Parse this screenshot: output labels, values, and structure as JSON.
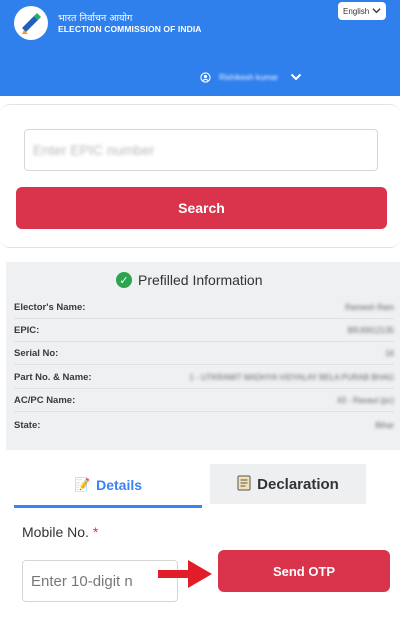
{
  "header": {
    "title_hindi": "भारत निर्वाचन आयोग",
    "title_english": "ELECTION COMMISSION OF INDIA",
    "language": "English",
    "user_name": "Rishikesh kumar"
  },
  "search": {
    "placeholder": "Enter EPIC number",
    "button_label": "Search"
  },
  "prefilled": {
    "title": "Prefilled Information",
    "rows": [
      {
        "label": "Elector's Name:",
        "value": "Ramesh Ram"
      },
      {
        "label": "EPIC:",
        "value": "BRJ0912135"
      },
      {
        "label": "Serial No:",
        "value": "16"
      },
      {
        "label": "Part No. & Name:",
        "value": "1 - UTKRAMIT MADHYA VIDYALAY BELA PURAB BHAG"
      },
      {
        "label": "AC/PC Name:",
        "value": "43 - Raxaul (pc)"
      },
      {
        "label": "State:",
        "value": "Bihar"
      }
    ]
  },
  "tabs": {
    "details_label": "Details",
    "declaration_label": "Declaration"
  },
  "mobile": {
    "label": "Mobile No.",
    "required_mark": "*",
    "placeholder": "Enter 10-digit n",
    "send_otp_label": "Send OTP"
  },
  "colors": {
    "header_blue": "#2f80ed",
    "button_red": "#d9344c",
    "tab_blue": "#3b82f6",
    "check_green": "#2ea44f"
  }
}
